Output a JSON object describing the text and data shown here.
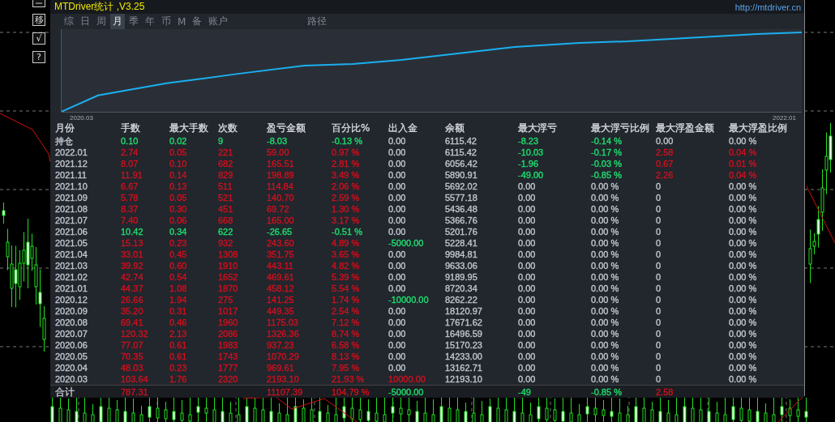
{
  "toolbar": {
    "buttons": [
      "移",
      "√",
      "?"
    ]
  },
  "window": {
    "title": "MTDriver统计 ,V3.25",
    "link": "http://mtdriver.cn"
  },
  "tabs": [
    {
      "label": "综",
      "selected": false
    },
    {
      "label": "日",
      "selected": false
    },
    {
      "label": "周",
      "selected": false
    },
    {
      "label": "月",
      "selected": true
    },
    {
      "label": "季",
      "selected": false
    },
    {
      "label": "年",
      "selected": false
    },
    {
      "label": "币",
      "selected": false
    },
    {
      "label": "M",
      "selected": false
    },
    {
      "label": "备",
      "selected": false
    },
    {
      "label": "账户",
      "selected": false
    },
    {
      "label": "路径",
      "selected": false
    }
  ],
  "equity_chart": {
    "start_label": "2020.03",
    "end_label": "2022.01"
  },
  "table": {
    "columns": [
      "月份",
      "手数",
      "最大手数",
      "次数",
      "盈亏金额",
      "百分比%",
      "出入金",
      "余额",
      "最大浮亏",
      "最大浮亏比例",
      "最大浮盈金额",
      "最大浮盈比例"
    ],
    "rows": [
      {
        "cells": [
          {
            "text": "持仓"
          },
          {
            "text": "0.10",
            "color": "#1fe070"
          },
          {
            "text": "0.02",
            "color": "#1fe070"
          },
          {
            "text": "9",
            "color": "#1fe070"
          },
          {
            "text": "-8.03",
            "color": "#1fe070"
          },
          {
            "text": "-0.13 %",
            "color": "#1fe070"
          },
          {
            "text": "0.00"
          },
          {
            "text": "6115.42"
          },
          {
            "text": "-8.23",
            "color": "#1fe070"
          },
          {
            "text": "-0.14 %",
            "color": "#1fe070"
          },
          {
            "text": "0.00"
          },
          {
            "text": "0.00 %"
          }
        ]
      },
      {
        "cells": [
          {
            "text": "2022.01"
          },
          {
            "text": "2.74",
            "color": "#d2101e"
          },
          {
            "text": "0.05",
            "color": "#d2101e"
          },
          {
            "text": "221",
            "color": "#d2101e"
          },
          {
            "text": "59.00",
            "color": "#d2101e"
          },
          {
            "text": "0.97 %",
            "color": "#d2101e"
          },
          {
            "text": "0.00"
          },
          {
            "text": "6115.42"
          },
          {
            "text": "-10.03",
            "color": "#1fe070"
          },
          {
            "text": "-0.17 %",
            "color": "#1fe070"
          },
          {
            "text": "2.58",
            "color": "#d2101e"
          },
          {
            "text": "0.04 %",
            "color": "#d2101e"
          }
        ]
      },
      {
        "cells": [
          {
            "text": "2021.12"
          },
          {
            "text": "8.07",
            "color": "#d2101e"
          },
          {
            "text": "0.10",
            "color": "#d2101e"
          },
          {
            "text": "682",
            "color": "#d2101e"
          },
          {
            "text": "165.51",
            "color": "#d2101e"
          },
          {
            "text": "2.81 %",
            "color": "#d2101e"
          },
          {
            "text": "0.00"
          },
          {
            "text": "6056.42"
          },
          {
            "text": "-1.96",
            "color": "#1fe070"
          },
          {
            "text": "-0.03 %",
            "color": "#1fe070"
          },
          {
            "text": "0.67",
            "color": "#d2101e"
          },
          {
            "text": "0.01 %",
            "color": "#d2101e"
          }
        ]
      },
      {
        "cells": [
          {
            "text": "2021.11"
          },
          {
            "text": "11.91",
            "color": "#d2101e"
          },
          {
            "text": "0.14",
            "color": "#d2101e"
          },
          {
            "text": "829",
            "color": "#d2101e"
          },
          {
            "text": "198.89",
            "color": "#d2101e"
          },
          {
            "text": "3.49 %",
            "color": "#d2101e"
          },
          {
            "text": "0.00"
          },
          {
            "text": "5890.91"
          },
          {
            "text": "-49.00",
            "color": "#1fe070"
          },
          {
            "text": "-0.85 %",
            "color": "#1fe070"
          },
          {
            "text": "2.26",
            "color": "#d2101e"
          },
          {
            "text": "0.04 %",
            "color": "#d2101e"
          }
        ]
      },
      {
        "cells": [
          {
            "text": "2021.10"
          },
          {
            "text": "6.67",
            "color": "#d2101e"
          },
          {
            "text": "0.13",
            "color": "#d2101e"
          },
          {
            "text": "511",
            "color": "#d2101e"
          },
          {
            "text": "114.84",
            "color": "#d2101e"
          },
          {
            "text": "2.06 %",
            "color": "#d2101e"
          },
          {
            "text": "0.00"
          },
          {
            "text": "5692.02"
          },
          {
            "text": "0.00"
          },
          {
            "text": "0.00 %"
          },
          {
            "text": "0"
          },
          {
            "text": "0.00 %"
          }
        ]
      },
      {
        "cells": [
          {
            "text": "2021.09"
          },
          {
            "text": "5.78",
            "color": "#d2101e"
          },
          {
            "text": "0.05",
            "color": "#d2101e"
          },
          {
            "text": "521",
            "color": "#d2101e"
          },
          {
            "text": "140.70",
            "color": "#d2101e"
          },
          {
            "text": "2.59 %",
            "color": "#d2101e"
          },
          {
            "text": "0.00"
          },
          {
            "text": "5577.18"
          },
          {
            "text": "0.00"
          },
          {
            "text": "0.00 %"
          },
          {
            "text": "0"
          },
          {
            "text": "0.00 %"
          }
        ]
      },
      {
        "cells": [
          {
            "text": "2021.08"
          },
          {
            "text": "8.37",
            "color": "#d2101e"
          },
          {
            "text": "0.30",
            "color": "#d2101e"
          },
          {
            "text": "451",
            "color": "#d2101e"
          },
          {
            "text": "69.72",
            "color": "#d2101e"
          },
          {
            "text": "1.30 %",
            "color": "#d2101e"
          },
          {
            "text": "0.00"
          },
          {
            "text": "5436.48"
          },
          {
            "text": "0.00"
          },
          {
            "text": "0.00 %"
          },
          {
            "text": "0"
          },
          {
            "text": "0.00 %"
          }
        ]
      },
      {
        "cells": [
          {
            "text": "2021.07"
          },
          {
            "text": "7.40",
            "color": "#d2101e"
          },
          {
            "text": "0.06",
            "color": "#d2101e"
          },
          {
            "text": "668",
            "color": "#d2101e"
          },
          {
            "text": "165.00",
            "color": "#d2101e"
          },
          {
            "text": "3.17 %",
            "color": "#d2101e"
          },
          {
            "text": "0.00"
          },
          {
            "text": "5366.76"
          },
          {
            "text": "0.00"
          },
          {
            "text": "0.00 %"
          },
          {
            "text": "0"
          },
          {
            "text": "0.00 %"
          }
        ]
      },
      {
        "cells": [
          {
            "text": "2021.06"
          },
          {
            "text": "10.42",
            "color": "#1fe070"
          },
          {
            "text": "0.34",
            "color": "#1fe070"
          },
          {
            "text": "622",
            "color": "#1fe070"
          },
          {
            "text": "-26.65",
            "color": "#1fe070"
          },
          {
            "text": "-0.51 %",
            "color": "#1fe070"
          },
          {
            "text": "0.00"
          },
          {
            "text": "5201.76"
          },
          {
            "text": "0.00"
          },
          {
            "text": "0.00 %"
          },
          {
            "text": "0"
          },
          {
            "text": "0.00 %"
          }
        ]
      },
      {
        "cells": [
          {
            "text": "2021.05"
          },
          {
            "text": "15.13",
            "color": "#d2101e"
          },
          {
            "text": "0.23",
            "color": "#d2101e"
          },
          {
            "text": "932",
            "color": "#d2101e"
          },
          {
            "text": "243.60",
            "color": "#d2101e"
          },
          {
            "text": "4.89 %",
            "color": "#d2101e"
          },
          {
            "text": "-5000.00",
            "color": "#1fe070"
          },
          {
            "text": "5228.41"
          },
          {
            "text": "0.00"
          },
          {
            "text": "0.00 %"
          },
          {
            "text": "0"
          },
          {
            "text": "0.00 %"
          }
        ]
      },
      {
        "cells": [
          {
            "text": "2021.04"
          },
          {
            "text": "33.01",
            "color": "#d2101e"
          },
          {
            "text": "0.45",
            "color": "#d2101e"
          },
          {
            "text": "1308",
            "color": "#d2101e"
          },
          {
            "text": "351.75",
            "color": "#d2101e"
          },
          {
            "text": "3.65 %",
            "color": "#d2101e"
          },
          {
            "text": "0.00"
          },
          {
            "text": "9984.81"
          },
          {
            "text": "0.00"
          },
          {
            "text": "0.00 %"
          },
          {
            "text": "0"
          },
          {
            "text": "0.00 %"
          }
        ]
      },
      {
        "cells": [
          {
            "text": "2021.03"
          },
          {
            "text": "39.92",
            "color": "#d2101e"
          },
          {
            "text": "0.60",
            "color": "#d2101e"
          },
          {
            "text": "1910",
            "color": "#d2101e"
          },
          {
            "text": "443.11",
            "color": "#d2101e"
          },
          {
            "text": "4.82 %",
            "color": "#d2101e"
          },
          {
            "text": "0.00"
          },
          {
            "text": "9633.06"
          },
          {
            "text": "0.00"
          },
          {
            "text": "0.00 %"
          },
          {
            "text": "0"
          },
          {
            "text": "0.00 %"
          }
        ]
      },
      {
        "cells": [
          {
            "text": "2021.02"
          },
          {
            "text": "42.74",
            "color": "#d2101e"
          },
          {
            "text": "0.54",
            "color": "#d2101e"
          },
          {
            "text": "1652",
            "color": "#d2101e"
          },
          {
            "text": "469.61",
            "color": "#d2101e"
          },
          {
            "text": "5.39 %",
            "color": "#d2101e"
          },
          {
            "text": "0.00"
          },
          {
            "text": "9189.95"
          },
          {
            "text": "0.00"
          },
          {
            "text": "0.00 %"
          },
          {
            "text": "0"
          },
          {
            "text": "0.00 %"
          }
        ]
      },
      {
        "cells": [
          {
            "text": "2021.01"
          },
          {
            "text": "44.37",
            "color": "#d2101e"
          },
          {
            "text": "1.08",
            "color": "#d2101e"
          },
          {
            "text": "1870",
            "color": "#d2101e"
          },
          {
            "text": "458.12",
            "color": "#d2101e"
          },
          {
            "text": "5.54 %",
            "color": "#d2101e"
          },
          {
            "text": "0.00"
          },
          {
            "text": "8720.34"
          },
          {
            "text": "0.00"
          },
          {
            "text": "0.00 %"
          },
          {
            "text": "0"
          },
          {
            "text": "0.00 %"
          }
        ]
      },
      {
        "cells": [
          {
            "text": "2020.12"
          },
          {
            "text": "26.66",
            "color": "#d2101e"
          },
          {
            "text": "1.94",
            "color": "#d2101e"
          },
          {
            "text": "275",
            "color": "#d2101e"
          },
          {
            "text": "141.25",
            "color": "#d2101e"
          },
          {
            "text": "1.74 %",
            "color": "#d2101e"
          },
          {
            "text": "-10000.00",
            "color": "#1fe070"
          },
          {
            "text": "8262.22"
          },
          {
            "text": "0.00"
          },
          {
            "text": "0.00 %"
          },
          {
            "text": "0"
          },
          {
            "text": "0.00 %"
          }
        ]
      },
      {
        "cells": [
          {
            "text": "2020.09"
          },
          {
            "text": "35.20",
            "color": "#d2101e"
          },
          {
            "text": "0.31",
            "color": "#d2101e"
          },
          {
            "text": "1017",
            "color": "#d2101e"
          },
          {
            "text": "449.35",
            "color": "#d2101e"
          },
          {
            "text": "2.54 %",
            "color": "#d2101e"
          },
          {
            "text": "0.00"
          },
          {
            "text": "18120.97"
          },
          {
            "text": "0.00"
          },
          {
            "text": "0.00 %"
          },
          {
            "text": "0"
          },
          {
            "text": "0.00 %"
          }
        ]
      },
      {
        "cells": [
          {
            "text": "2020.08"
          },
          {
            "text": "69.41",
            "color": "#d2101e"
          },
          {
            "text": "0.46",
            "color": "#d2101e"
          },
          {
            "text": "1960",
            "color": "#d2101e"
          },
          {
            "text": "1175.03",
            "color": "#d2101e"
          },
          {
            "text": "7.12 %",
            "color": "#d2101e"
          },
          {
            "text": "0.00"
          },
          {
            "text": "17671.62"
          },
          {
            "text": "0.00"
          },
          {
            "text": "0.00 %"
          },
          {
            "text": "0"
          },
          {
            "text": "0.00 %"
          }
        ]
      },
      {
        "cells": [
          {
            "text": "2020.07"
          },
          {
            "text": "120.32",
            "color": "#d2101e"
          },
          {
            "text": "2.13",
            "color": "#d2101e"
          },
          {
            "text": "2086",
            "color": "#d2101e"
          },
          {
            "text": "1326.36",
            "color": "#d2101e"
          },
          {
            "text": "8.74 %",
            "color": "#d2101e"
          },
          {
            "text": "0.00"
          },
          {
            "text": "16496.59"
          },
          {
            "text": "0.00"
          },
          {
            "text": "0.00 %"
          },
          {
            "text": "0"
          },
          {
            "text": "0.00 %"
          }
        ]
      },
      {
        "cells": [
          {
            "text": "2020.06"
          },
          {
            "text": "77.07",
            "color": "#d2101e"
          },
          {
            "text": "0.61",
            "color": "#d2101e"
          },
          {
            "text": "1983",
            "color": "#d2101e"
          },
          {
            "text": "937.23",
            "color": "#d2101e"
          },
          {
            "text": "6.58 %",
            "color": "#d2101e"
          },
          {
            "text": "0.00"
          },
          {
            "text": "15170.23"
          },
          {
            "text": "0.00"
          },
          {
            "text": "0.00 %"
          },
          {
            "text": "0"
          },
          {
            "text": "0.00 %"
          }
        ]
      },
      {
        "cells": [
          {
            "text": "2020.05"
          },
          {
            "text": "70.35",
            "color": "#d2101e"
          },
          {
            "text": "0.61",
            "color": "#d2101e"
          },
          {
            "text": "1743",
            "color": "#d2101e"
          },
          {
            "text": "1070.29",
            "color": "#d2101e"
          },
          {
            "text": "8.13 %",
            "color": "#d2101e"
          },
          {
            "text": "0.00"
          },
          {
            "text": "14233.00"
          },
          {
            "text": "0.00"
          },
          {
            "text": "0.00 %"
          },
          {
            "text": "0"
          },
          {
            "text": "0.00 %"
          }
        ]
      },
      {
        "cells": [
          {
            "text": "2020.04"
          },
          {
            "text": "48.03",
            "color": "#d2101e"
          },
          {
            "text": "0.23",
            "color": "#d2101e"
          },
          {
            "text": "1777",
            "color": "#d2101e"
          },
          {
            "text": "969.61",
            "color": "#d2101e"
          },
          {
            "text": "7.95 %",
            "color": "#d2101e"
          },
          {
            "text": "0.00"
          },
          {
            "text": "13162.71"
          },
          {
            "text": "0.00"
          },
          {
            "text": "0.00 %"
          },
          {
            "text": "0"
          },
          {
            "text": "0.00 %"
          }
        ]
      },
      {
        "cells": [
          {
            "text": "2020.03"
          },
          {
            "text": "103.64",
            "color": "#d2101e"
          },
          {
            "text": "1.76",
            "color": "#d2101e"
          },
          {
            "text": "2320",
            "color": "#d2101e"
          },
          {
            "text": "2193.10",
            "color": "#d2101e"
          },
          {
            "text": "21.93 %",
            "color": "#d2101e"
          },
          {
            "text": "10000.00",
            "color": "#d2101e"
          },
          {
            "text": "12193.10"
          },
          {
            "text": "0.00"
          },
          {
            "text": "0.00 %"
          },
          {
            "text": "0"
          },
          {
            "text": "0.00 %"
          }
        ]
      }
    ],
    "total": {
      "label": {
        "text": "合计"
      },
      "lots": {
        "text": "787.31",
        "color": "#d2101e"
      },
      "profit": {
        "text": "11107.39",
        "color": "#d2101e"
      },
      "percent": {
        "text": "104.79 %",
        "color": "#d2101e"
      },
      "deposit": {
        "text": "-5000.00",
        "color": "#1fe070"
      },
      "max_float_loss": {
        "text": "-49",
        "color": "#1fe070"
      },
      "max_float_loss_ratio": {
        "text": "-0.85 %",
        "color": "#1fe070"
      },
      "max_float_profit": {
        "text": "2.58",
        "color": "#d2101e"
      }
    }
  }
}
